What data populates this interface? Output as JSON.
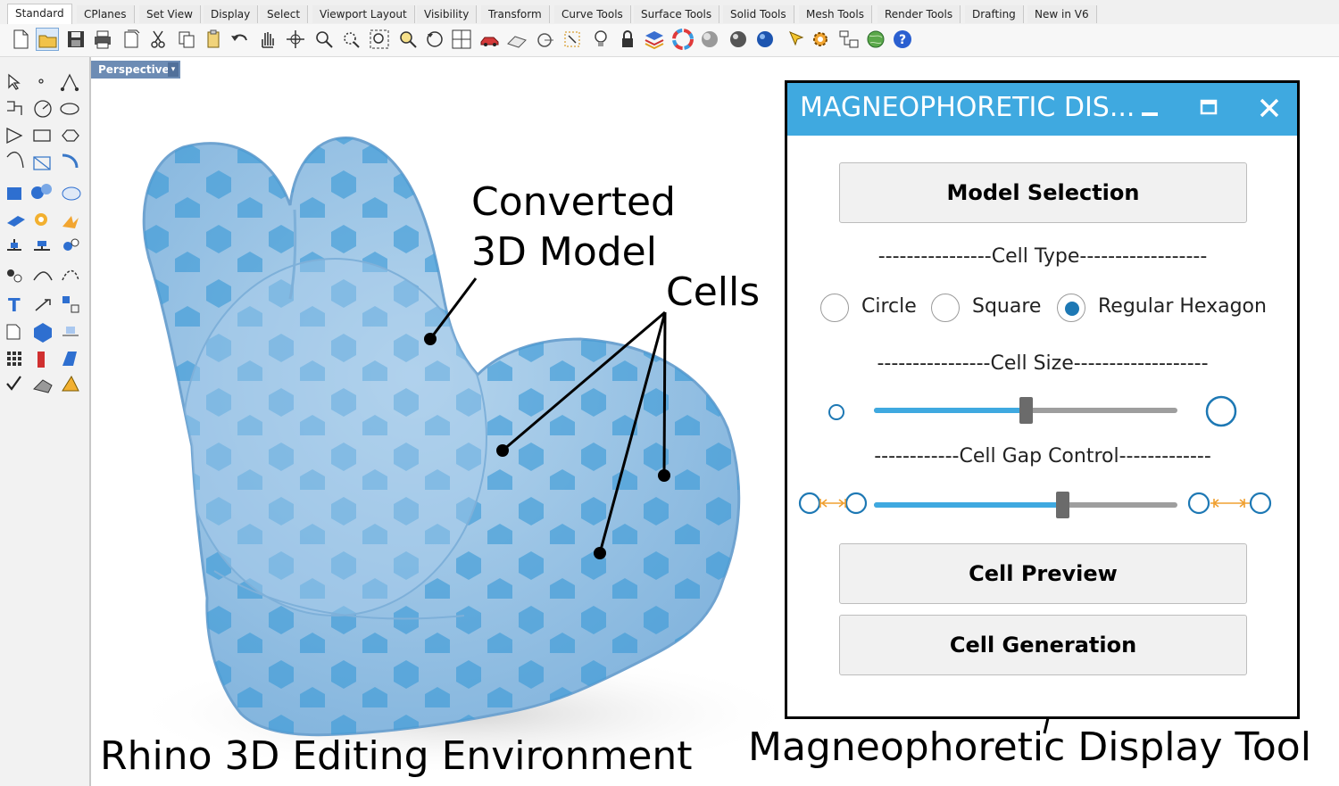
{
  "toolbar": {
    "tabs": [
      "Standard",
      "CPlanes",
      "Set View",
      "Display",
      "Select",
      "Viewport Layout",
      "Visibility",
      "Transform",
      "Curve Tools",
      "Surface Tools",
      "Solid Tools",
      "Mesh Tools",
      "Render Tools",
      "Drafting",
      "New in V6"
    ],
    "active_tab": "Standard"
  },
  "viewport": {
    "label": "Perspective",
    "dropdown_glyph": "▾"
  },
  "annotations": {
    "model_label_line1": "Converted",
    "model_label_line2": "3D Model",
    "cells_label": "Cells",
    "environment_caption": "Rhino 3D Editing Environment",
    "tool_caption": "Magneophoretic Display Tool"
  },
  "dialog": {
    "title": "MAGNEOPHORETIC DIS...",
    "model_selection_label": "Model Selection",
    "cell_type_header": "----------------Cell Type------------------",
    "cell_type_options": [
      "Circle",
      "Square",
      "Regular Hexagon"
    ],
    "cell_type_selected": "Regular Hexagon",
    "cell_size_header": "----------------Cell Size-------------------",
    "cell_size_value": 0.5,
    "cell_gap_header": "------------Cell Gap Control-------------",
    "cell_gap_value": 0.62,
    "cell_preview_label": "Cell Preview",
    "cell_generation_label": "Cell Generation"
  },
  "colors": {
    "title_bar": "#3fa9e0",
    "slider_fill": "#3fa9e0",
    "slider_rest": "#9e9e9e",
    "radio_selected": "#1d78b4",
    "model_fill": "#8fbde0",
    "cell_fill": "#3a9ad8",
    "gap_arrow": "#f0a030"
  }
}
